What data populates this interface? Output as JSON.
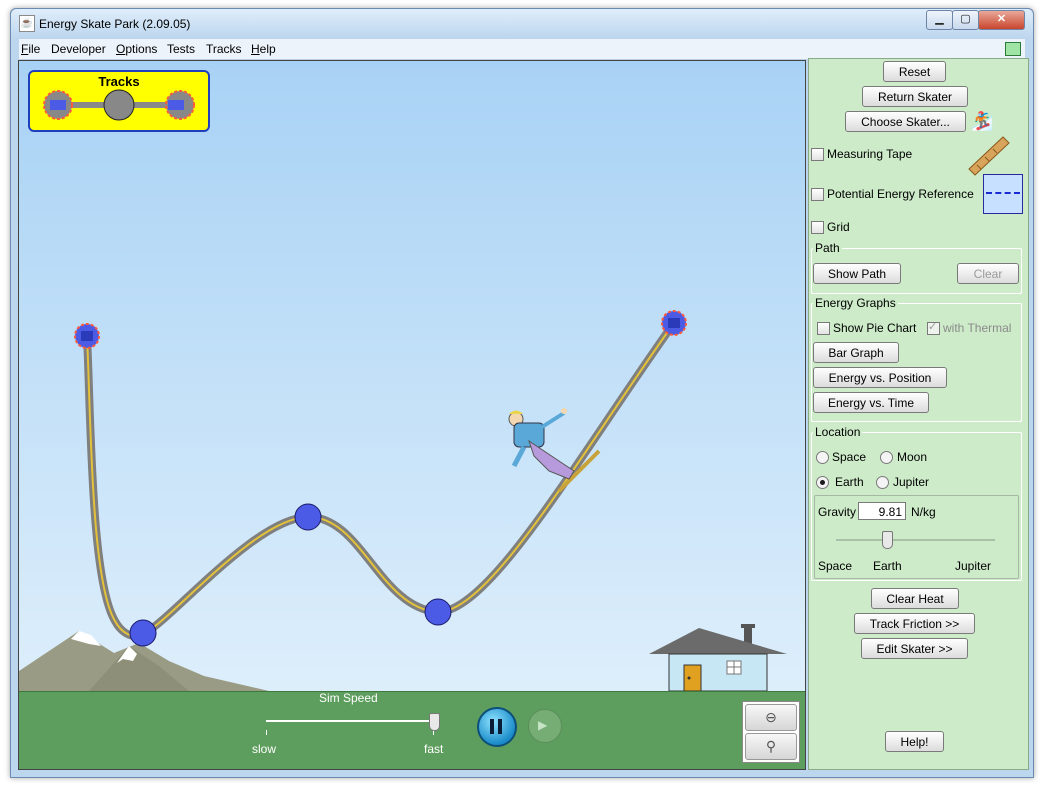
{
  "window": {
    "title": "Energy Skate Park (2.09.05)",
    "controls": {
      "minimize": "▁",
      "maximize": "▢",
      "close": "✕"
    }
  },
  "menu": [
    {
      "label": "File",
      "underline": "F",
      "rest": "ile"
    },
    {
      "label": "Developer",
      "underline": "",
      "rest": "Developer"
    },
    {
      "label": "Options",
      "underline": "O",
      "rest": "ptions"
    },
    {
      "label": "Tests",
      "underline": "",
      "rest": "Tests"
    },
    {
      "label": "Tracks",
      "underline": "",
      "rest": "Tracks"
    },
    {
      "label": "Help",
      "underline": "H",
      "rest": "elp"
    }
  ],
  "sim": {
    "tracks_panel_title": "Tracks",
    "sim_speed": {
      "label": "Sim Speed",
      "slow": "slow",
      "fast": "fast",
      "value": 0.98
    },
    "zoom": {
      "zoom_in_icon": "magnifier-minus-icon",
      "zoom_out_icon": "magnifier-icon"
    },
    "colors": {
      "sky_top": "#a8d2f5",
      "ground": "#5d9d5d",
      "track": "#8a8a8a",
      "track_center": "#e3c23a",
      "control_point": "#4b5be6",
      "control_point_end_ring": "#ff5a3c"
    }
  },
  "controls": {
    "reset": "Reset",
    "return_skater": "Return Skater",
    "choose_skater": "Choose Skater...",
    "measuring_tape": {
      "label": "Measuring Tape",
      "checked": false
    },
    "potential_energy_reference": {
      "label": "Potential Energy Reference",
      "checked": false
    },
    "grid": {
      "label": "Grid",
      "checked": false
    },
    "path": {
      "title": "Path",
      "show_path": "Show Path",
      "clear": "Clear"
    },
    "energy_graphs": {
      "title": "Energy Graphs",
      "show_pie_chart": {
        "label": "Show Pie Chart",
        "checked": false
      },
      "with_thermal": {
        "label": "with Thermal",
        "checked": true
      },
      "bar_graph": "Bar Graph",
      "energy_vs_position": "Energy vs. Position",
      "energy_vs_time": "Energy vs. Time"
    },
    "location": {
      "title": "Location",
      "options": [
        {
          "label": "Space",
          "selected": false
        },
        {
          "label": "Moon",
          "selected": false
        },
        {
          "label": "Earth",
          "selected": true
        },
        {
          "label": "Jupiter",
          "selected": false
        }
      ],
      "gravity": {
        "label": "Gravity",
        "value": "9.81",
        "unit": "N/kg"
      },
      "slider_labels": {
        "space": "Space",
        "earth": "Earth",
        "jupiter": "Jupiter"
      }
    },
    "clear_heat": "Clear Heat",
    "track_friction": "Track Friction >>",
    "edit_skater": "Edit Skater >>",
    "help": "Help!"
  }
}
